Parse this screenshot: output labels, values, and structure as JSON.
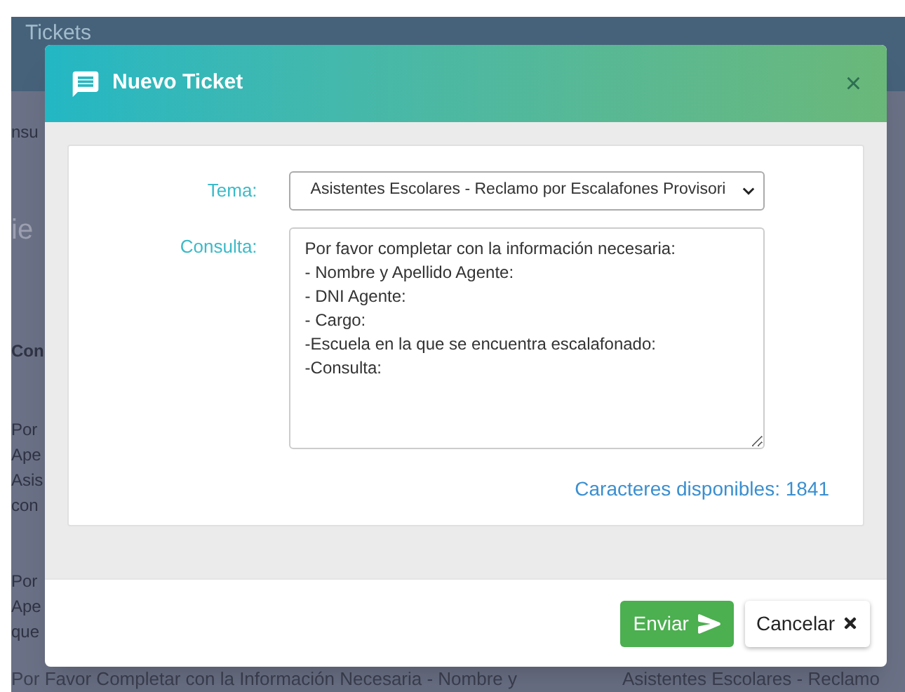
{
  "page": {
    "title": "Tickets",
    "fragments": [
      "nsu",
      "ie",
      "Con",
      "Por",
      "Ape",
      "Asis",
      "con",
      "Por",
      "Ape",
      "que"
    ],
    "bottom_row": {
      "consulta": "Por Favor Completar con la Información Necesaria - Nombre y",
      "tema": "Asistentes Escolares - Reclamo"
    }
  },
  "modal": {
    "title": "Nuevo Ticket",
    "close": "×",
    "tema": {
      "label": "Tema:",
      "value": "Asistentes Escolares - Reclamo por Escalafones Provisori"
    },
    "consulta": {
      "label": "Consulta:",
      "value": "Por favor completar con la información necesaria:\n- Nombre y Apellido Agente:\n- DNI Agente:\n- Cargo:\n-Escuela en la que se encuentra escalafonado:\n-Consulta:"
    },
    "counter": "Caracteres disponibles: 1841",
    "buttons": [
      {
        "label": "Enviar",
        "kind": "primary"
      },
      {
        "label": "Cancelar",
        "kind": "secondary"
      }
    ]
  }
}
